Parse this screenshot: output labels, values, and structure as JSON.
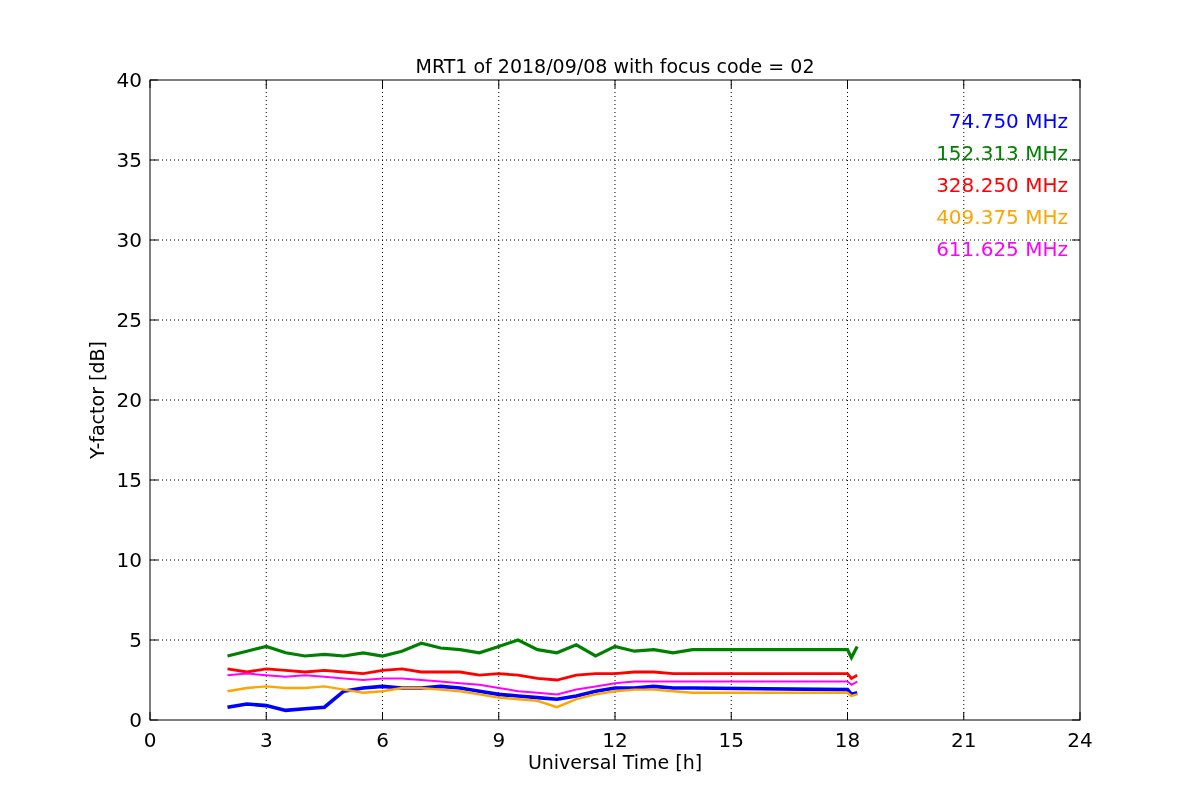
{
  "chart_data": {
    "type": "line",
    "title": "MRT1 of 2018/09/08 with focus code = 02",
    "xlabel": "Universal Time [h]",
    "ylabel": "Y-factor [dB]",
    "x": [
      2,
      2.5,
      3,
      3.5,
      4,
      4.5,
      5,
      5.5,
      6,
      6.5,
      7,
      7.5,
      8,
      8.5,
      9,
      9.5,
      10,
      10.5,
      11,
      11.5,
      12,
      12.5,
      13,
      13.5,
      14,
      18,
      18.1,
      18.25
    ],
    "series": [
      {
        "name": "74.750 MHz",
        "color": "#0000ff",
        "values": [
          0.8,
          1.0,
          0.9,
          0.6,
          0.7,
          0.8,
          1.8,
          2.0,
          2.1,
          2.0,
          2.0,
          2.1,
          2.0,
          1.8,
          1.6,
          1.5,
          1.4,
          1.3,
          1.5,
          1.8,
          2.0,
          2.0,
          2.1,
          2.0,
          2.0,
          1.9,
          1.6,
          1.7
        ]
      },
      {
        "name": "152.313 MHz",
        "color": "#008000",
        "values": [
          4.0,
          4.3,
          4.6,
          4.2,
          4.0,
          4.1,
          4.0,
          4.2,
          4.0,
          4.3,
          4.8,
          4.5,
          4.4,
          4.2,
          4.6,
          5.0,
          4.4,
          4.2,
          4.7,
          4.0,
          4.6,
          4.3,
          4.4,
          4.2,
          4.4,
          4.4,
          3.9,
          4.6
        ]
      },
      {
        "name": "328.250 MHz",
        "color": "#ff0000",
        "values": [
          3.2,
          3.0,
          3.2,
          3.1,
          3.0,
          3.1,
          3.0,
          2.9,
          3.1,
          3.2,
          3.0,
          3.0,
          3.0,
          2.8,
          2.9,
          2.8,
          2.6,
          2.5,
          2.8,
          2.9,
          2.9,
          3.0,
          3.0,
          2.9,
          2.9,
          2.9,
          2.6,
          2.8
        ]
      },
      {
        "name": "409.375 MHz",
        "color": "#ffa500",
        "values": [
          1.8,
          2.0,
          2.1,
          2.0,
          2.0,
          2.1,
          1.9,
          1.7,
          1.8,
          2.0,
          2.0,
          1.9,
          1.8,
          1.6,
          1.4,
          1.3,
          1.2,
          0.8,
          1.3,
          1.6,
          1.8,
          1.9,
          1.9,
          1.8,
          1.7,
          1.7,
          1.5,
          1.6
        ]
      },
      {
        "name": "611.625 MHz",
        "color": "#ff00ff",
        "values": [
          2.8,
          2.9,
          2.8,
          2.7,
          2.8,
          2.7,
          2.6,
          2.5,
          2.6,
          2.6,
          2.5,
          2.4,
          2.3,
          2.2,
          2.0,
          1.8,
          1.7,
          1.6,
          1.9,
          2.1,
          2.3,
          2.4,
          2.4,
          2.4,
          2.4,
          2.4,
          2.2,
          2.4
        ]
      }
    ],
    "grid": true,
    "xlim": [
      0,
      24
    ],
    "ylim": [
      0,
      40
    ],
    "xticks": [
      0,
      3,
      6,
      9,
      12,
      15,
      18,
      21,
      24
    ],
    "yticks": [
      0,
      5,
      10,
      15,
      20,
      25,
      30,
      35,
      40
    ]
  }
}
